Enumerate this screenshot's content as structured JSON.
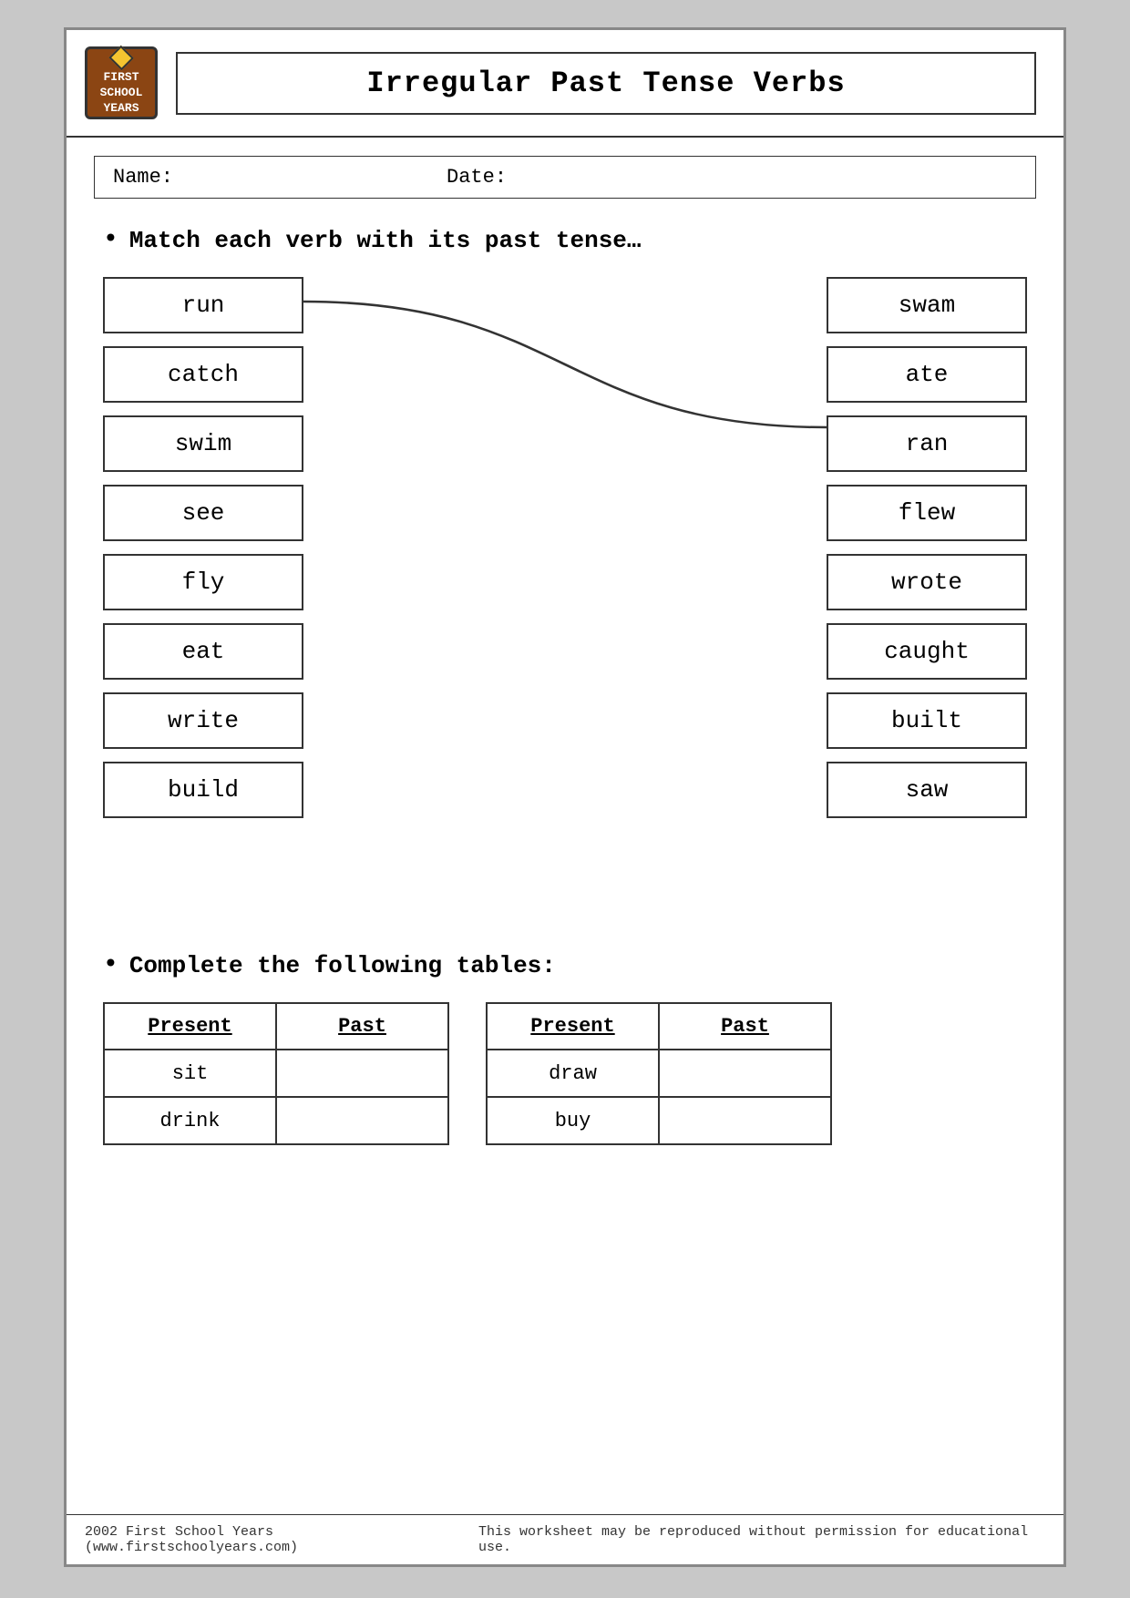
{
  "header": {
    "logo_line1": "FIRST",
    "logo_line2": "SCHOOL",
    "logo_line3": "YEARS",
    "title": "Irregular Past Tense Verbs"
  },
  "name_date": {
    "name_label": "Name:",
    "date_label": "Date:"
  },
  "instruction1": "Match each verb with its past tense…",
  "left_verbs": [
    {
      "word": "run"
    },
    {
      "word": "catch"
    },
    {
      "word": "swim"
    },
    {
      "word": "see"
    },
    {
      "word": "fly"
    },
    {
      "word": "eat"
    },
    {
      "word": "write"
    },
    {
      "word": "build"
    }
  ],
  "right_verbs": [
    {
      "word": "swam"
    },
    {
      "word": "ate"
    },
    {
      "word": "ran"
    },
    {
      "word": "flew"
    },
    {
      "word": "wrote"
    },
    {
      "word": "caught"
    },
    {
      "word": "built"
    },
    {
      "word": "saw"
    }
  ],
  "instruction2": "Complete the following tables:",
  "table1": {
    "col1": "Present",
    "col2": "Past",
    "rows": [
      {
        "present": "sit",
        "past": ""
      },
      {
        "present": "drink",
        "past": ""
      }
    ]
  },
  "table2": {
    "col1": "Present",
    "col2": "Past",
    "rows": [
      {
        "present": "draw",
        "past": ""
      },
      {
        "present": "buy",
        "past": ""
      }
    ]
  },
  "footer": {
    "left": "2002 First School Years  (www.firstschoolyears.com)",
    "right": "This worksheet may be reproduced without permission for educational use."
  }
}
